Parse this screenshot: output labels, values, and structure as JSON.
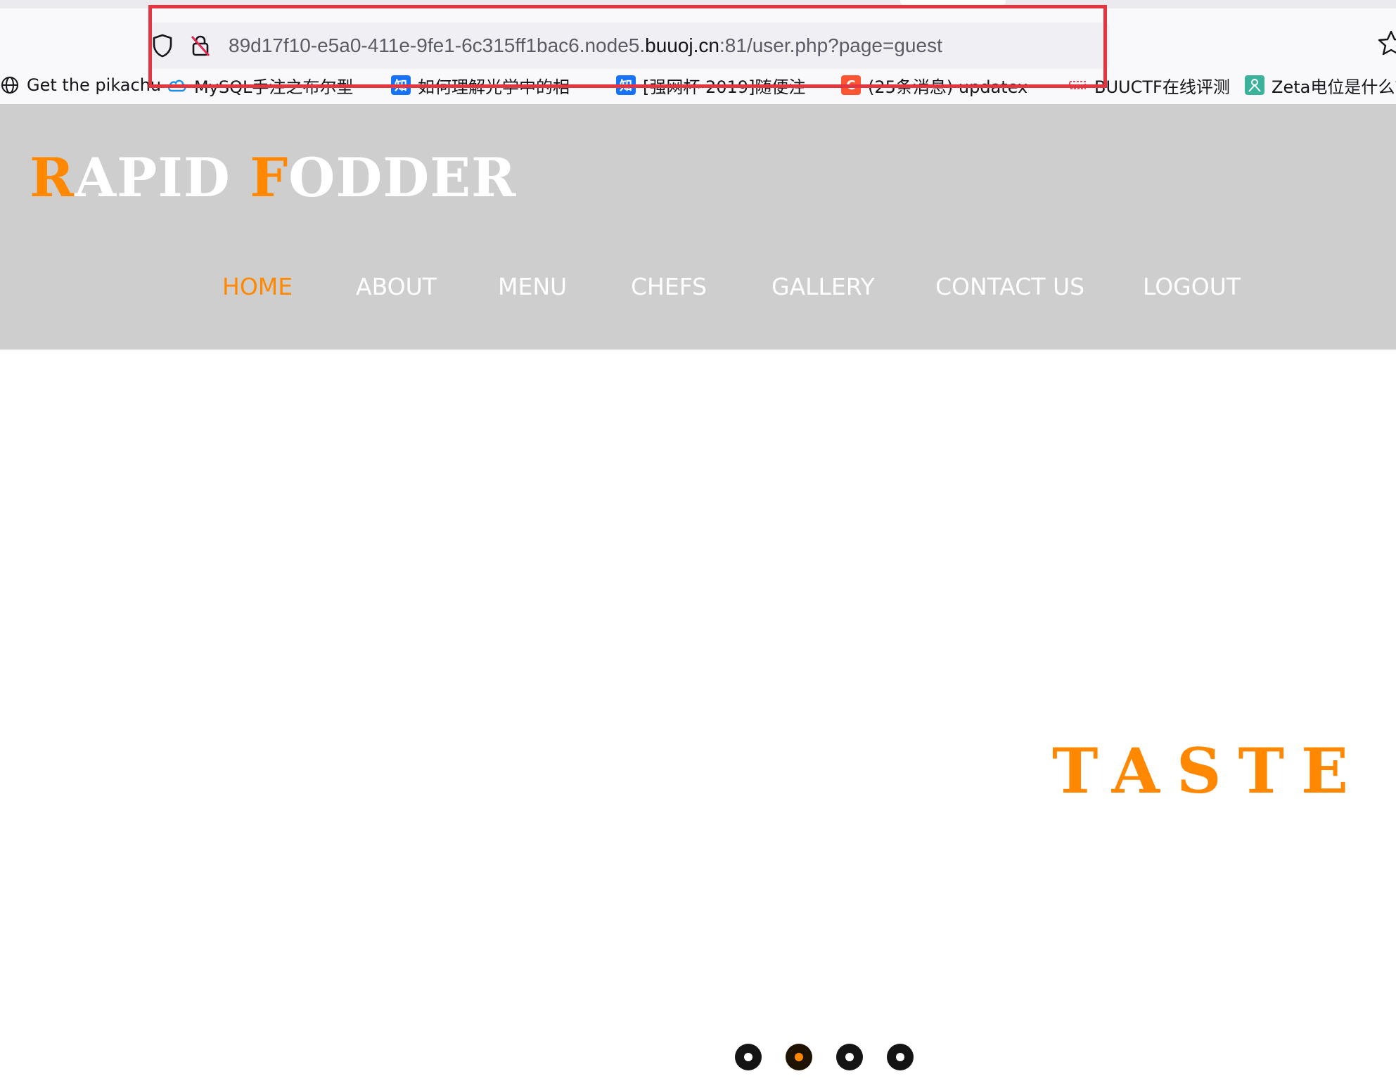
{
  "browser": {
    "url": {
      "prefix": "89d17f10-e5a0-411e-9fe1-6c315ff1bac6.node5.",
      "domain": "buuoj.cn",
      "suffix": ":81/user.php?page=guest"
    },
    "icons": {
      "tracking": "shield-icon",
      "insecure": "crossed-lock-icon",
      "bookmark": "star-icon"
    },
    "bookmarks": [
      {
        "label": "Get the pikachu",
        "icon": "globe-icon"
      },
      {
        "label": "MySQL手注之布尔型",
        "icon": "cloud-icon"
      },
      {
        "label": "如何理解光学中的相",
        "icon": "zhihu-icon"
      },
      {
        "label": "[强网杯 2019]随便注",
        "icon": "zhihu-icon"
      },
      {
        "label": "(25条消息) updatex",
        "icon": "csdn-icon"
      },
      {
        "label": "BUUCTF在线评测",
        "icon": "buuctf-icon"
      },
      {
        "label": "Zeta电位是什么？",
        "icon": "zeta-icon"
      }
    ]
  },
  "site": {
    "logo": {
      "first_initial": "R",
      "first_rest": "APID ",
      "second_initial": "F",
      "second_rest": "ODDER"
    },
    "nav": [
      {
        "label": "HOME",
        "active": true
      },
      {
        "label": "ABOUT",
        "active": false
      },
      {
        "label": "MENU",
        "active": false
      },
      {
        "label": "CHEFS",
        "active": false
      },
      {
        "label": "GALLERY",
        "active": false
      },
      {
        "label": "CONTACT US",
        "active": false
      },
      {
        "label": "LOGOUT",
        "active": false
      }
    ],
    "hero": {
      "headline": "TASTE"
    },
    "slider": {
      "count": 4,
      "active_index": 1
    }
  },
  "colors": {
    "accent": "#ff8800",
    "header_bg": "#cecece",
    "highlight": "#e53640"
  }
}
